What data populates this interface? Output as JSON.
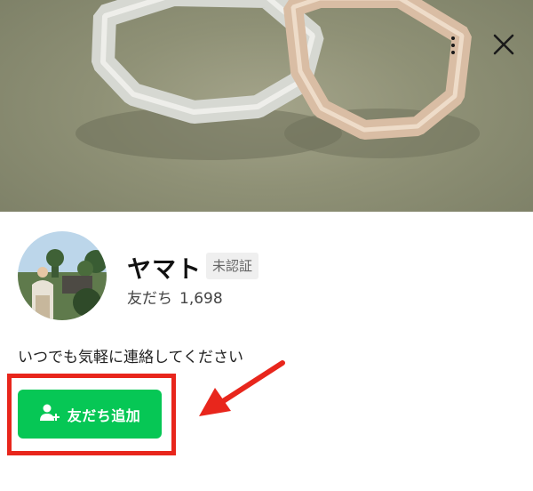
{
  "cover": {
    "image": "two wedding rings on green felt"
  },
  "header": {
    "menu_icon": "more-vertical-icon",
    "close_icon": "close-icon"
  },
  "profile": {
    "avatar": "person standing outdoors near trees",
    "name": "ヤマト",
    "badge": "未認証",
    "friends_label": "友だち",
    "friends_count": "1,698",
    "status_message": "いつでも気軽に連絡してください"
  },
  "add_friend": {
    "label": "友だち追加",
    "icon": "add-user-icon"
  },
  "annotation": {
    "highlight_color": "#e8261c",
    "arrow_color": "#e8261c"
  },
  "colors": {
    "line_green": "#06c755",
    "badge_bg": "#efefef"
  }
}
